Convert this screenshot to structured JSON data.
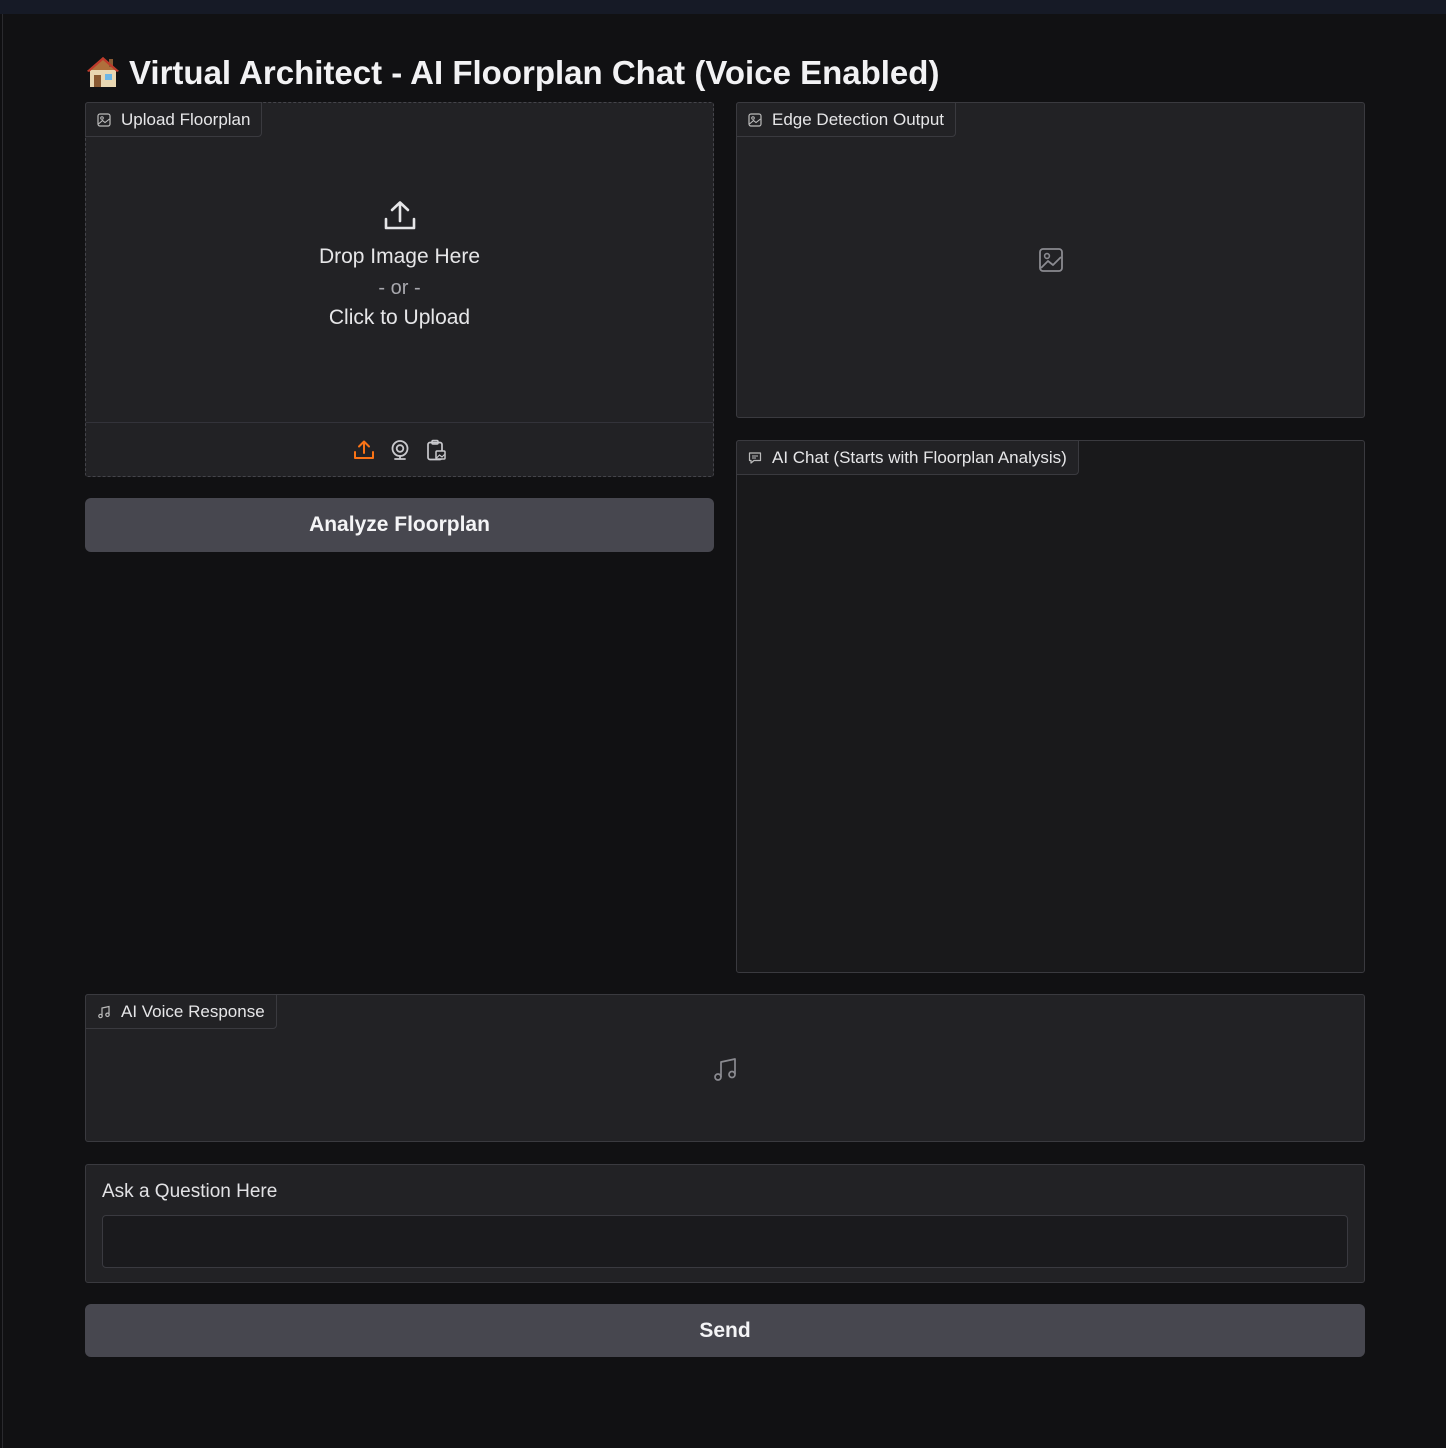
{
  "title": {
    "emoji_icon": "house-icon",
    "text": "Virtual Architect - AI Floorplan Chat (Voice Enabled)"
  },
  "upload": {
    "label": "Upload Floorplan",
    "icon": "image-icon",
    "drop_text": "Drop Image Here",
    "or_text": "- or -",
    "click_text": "Click to Upload",
    "tools": [
      "upload-icon",
      "webcam-icon",
      "clipboard-icon"
    ],
    "active_tool_color": "#f97316"
  },
  "analyze_button": {
    "label": "Analyze Floorplan"
  },
  "edge_output": {
    "label": "Edge Detection Output",
    "icon": "image-icon"
  },
  "chat": {
    "label": "AI Chat (Starts with Floorplan Analysis)",
    "icon": "chat-icon"
  },
  "voice": {
    "label": "AI Voice Response",
    "icon": "music-icon"
  },
  "question": {
    "label": "Ask a Question Here",
    "value": "",
    "placeholder": ""
  },
  "send_button": {
    "label": "Send"
  }
}
